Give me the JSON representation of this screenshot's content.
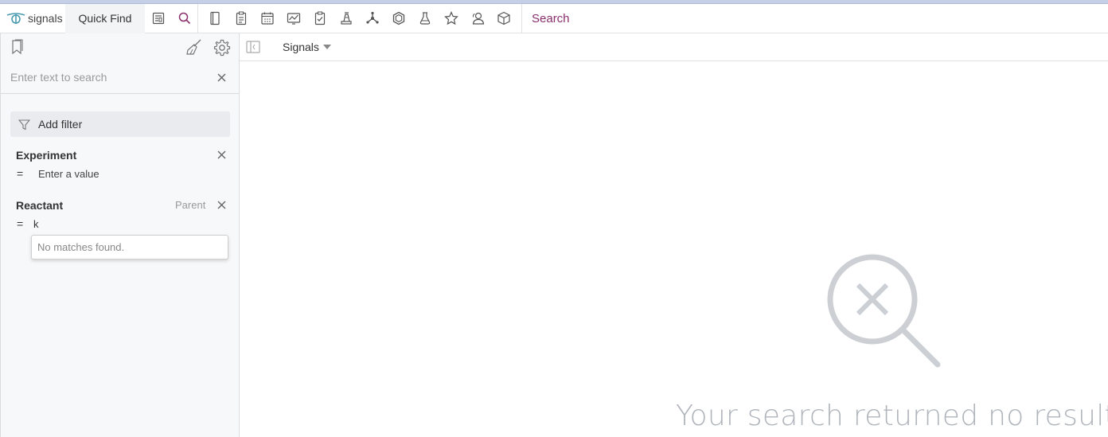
{
  "app": {
    "name": "signals",
    "quick_find": "Quick Find",
    "search_link": "Search"
  },
  "toolbar": {
    "icons": [
      "reports-icon",
      "search-icon",
      "notebook-icon",
      "clipboard-icon",
      "calendar-icon",
      "chart-icon",
      "checklist-icon",
      "lab-icon",
      "molecule-icon",
      "hexagon-icon",
      "flask-icon",
      "star-icon",
      "users-icon",
      "cube-icon"
    ],
    "accent_color": "#8b2f6d"
  },
  "sidebar": {
    "search_placeholder": "Enter text to search",
    "add_filter_label": "Add filter",
    "filters": [
      {
        "title": "Experiment",
        "operator": "=",
        "value_placeholder": "Enter a value",
        "value": ""
      },
      {
        "title": "Reactant",
        "parent_label": "Parent",
        "operator": "=",
        "value": "k"
      }
    ],
    "dropdown_message": "No matches found."
  },
  "main": {
    "title": "Signals",
    "empty_message": "Your search returned no results."
  }
}
